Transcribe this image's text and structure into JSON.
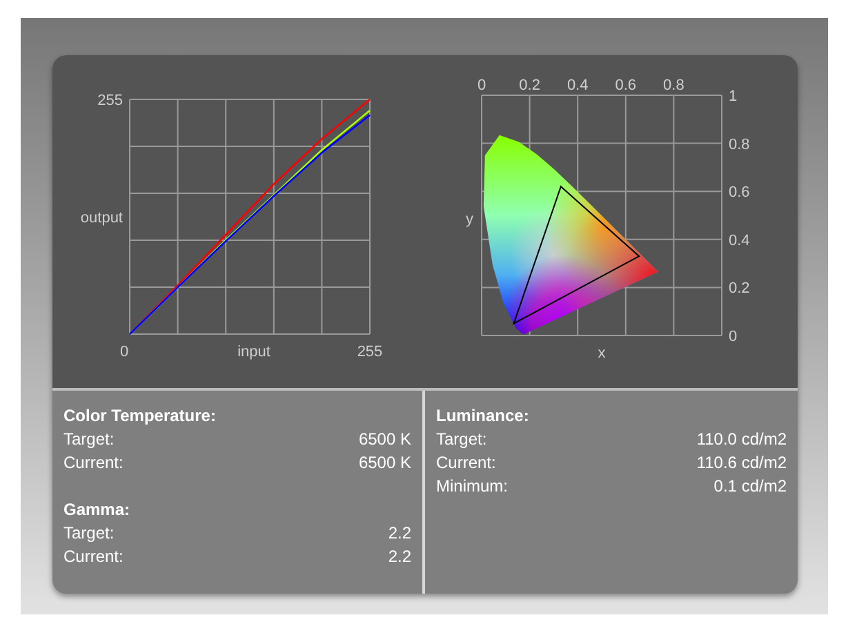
{
  "curves_chart": {
    "xlabel": "input",
    "ylabel": "output",
    "y_top_label": "255",
    "x_start_label": "0",
    "x_end_label": "255"
  },
  "gamut_chart": {
    "xlabel": "x",
    "ylabel": "y",
    "xtick_labels": [
      "0",
      "0.2",
      "0.4",
      "0.6",
      "0.8"
    ],
    "ytick_labels": [
      "1",
      "0.8",
      "0.6",
      "0.4",
      "0.2",
      "0"
    ]
  },
  "columns": [
    {
      "groups": [
        {
          "title": "Color Temperature:",
          "rows": [
            {
              "label": "Target:",
              "value": "6500 K"
            },
            {
              "label": "Current:",
              "value": "6500 K"
            }
          ]
        },
        {
          "title": "Gamma:",
          "rows": [
            {
              "label": "Target:",
              "value": "2.2"
            },
            {
              "label": "Current:",
              "value": "2.2"
            }
          ]
        }
      ]
    },
    {
      "groups": [
        {
          "title": "Luminance:",
          "rows": [
            {
              "label": "Target:",
              "value": "110.0 cd/m2"
            },
            {
              "label": "Current:",
              "value": "110.6 cd/m2"
            },
            {
              "label": "Minimum:",
              "value": "0.1 cd/m2"
            }
          ]
        }
      ]
    }
  ]
}
